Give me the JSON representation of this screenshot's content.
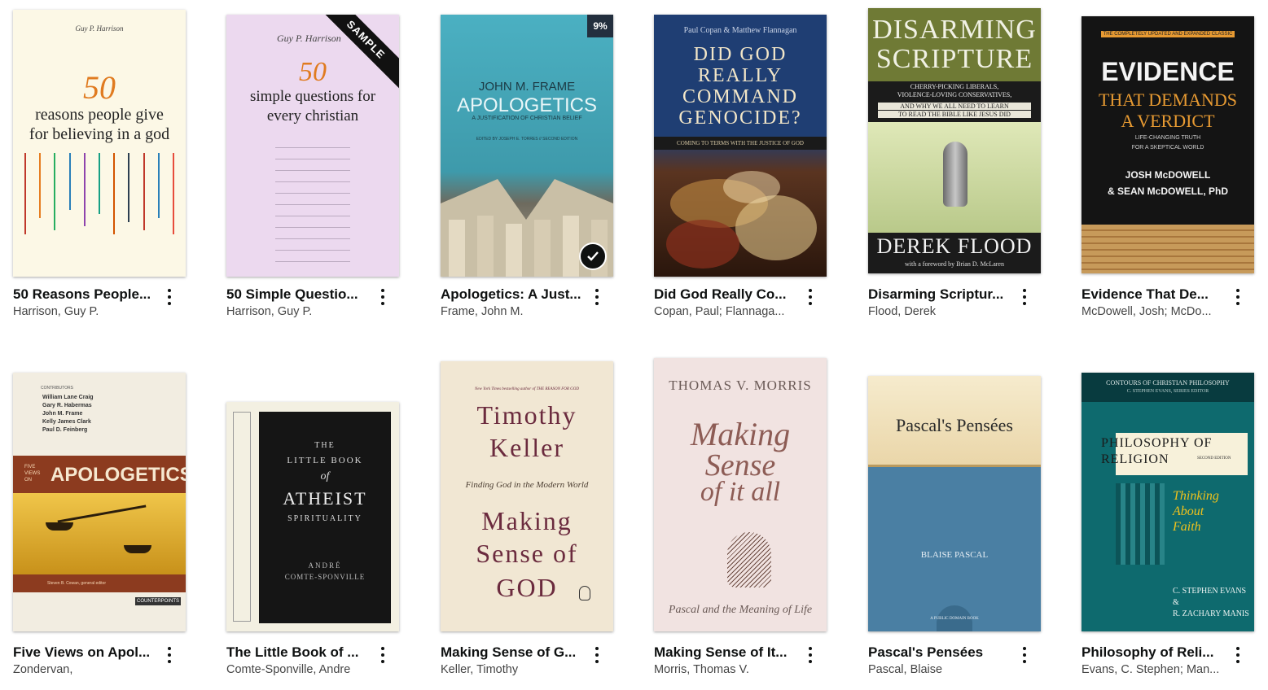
{
  "books": [
    {
      "title": "50 Reasons People...",
      "author": "Harrison, Guy P.",
      "cover": {
        "author": "Guy P. Harrison",
        "number": "50",
        "line1": "reasons people give",
        "line2": "for believing in a god",
        "bg": "#fcf8e6"
      }
    },
    {
      "title": "50 Simple Questio...",
      "author": "Harrison, Guy P.",
      "badge": "SAMPLE",
      "cover": {
        "author": "Guy P. Harrison",
        "number": "50",
        "line1": "simple questions for",
        "line2": "every christian",
        "bg": "#ecd9ef"
      }
    },
    {
      "title": "Apologetics: A Just...",
      "author": "Frame, John M.",
      "progress": "9%",
      "cover": {
        "author": "JOHN M. FRAME",
        "main": "APOLOGETICS",
        "sub": "A JUSTIFICATION OF CHRISTIAN BELIEF",
        "editor": "EDITED BY JOSEPH E. TORRES // SECOND EDITION",
        "bg": "#3e9aab"
      }
    },
    {
      "title": "Did God Really Co...",
      "author": "Copan, Paul; Flannaga...",
      "cover": {
        "author": "Paul Copan & Matthew Flannagan",
        "l1": "DID GOD",
        "l2": "REALLY",
        "l3": "COMMAND",
        "l4": "GENOCIDE?",
        "sub": "COMING TO TERMS WITH THE JUSTICE OF GOD",
        "bg": "#1f3e73"
      }
    },
    {
      "title": "Disarming Scriptur...",
      "author": "Flood, Derek",
      "cover": {
        "l1": "DISARMING",
        "l2": "SCRIPTURE",
        "sub1": "CHERRY-PICKING LIBERALS,",
        "sub2": "VIOLENCE-LOVING CONSERVATIVES,",
        "sub3": "AND WHY WE ALL NEED TO LEARN",
        "sub4": "TO READ THE BIBLE LIKE JESUS DID",
        "author": "DEREK FLOOD",
        "foreword": "with a foreword by Brian D. McLaren",
        "bg": "#1b1b1b"
      }
    },
    {
      "title": "Evidence That De...",
      "author": "McDowell, Josh; McDo...",
      "cover": {
        "banner": "THE COMPLETELY UPDATED AND EXPANDED CLASSIC",
        "l1": "EVIDENCE",
        "l2": "THAT DEMANDS",
        "l3": "A VERDICT",
        "sub1": "LIFE-CHANGING TRUTH",
        "sub2": "FOR A SKEPTICAL WORLD",
        "a1": "JOSH McDOWELL",
        "a2": "& SEAN McDOWELL, PhD",
        "bg": "#141414"
      }
    },
    {
      "title": "Five Views on Apol...",
      "author": "Zondervan,",
      "cover": {
        "contributors_label": "CONTRIBUTORS",
        "names": [
          "William Lane Craig",
          "Gary R. Habermas",
          "John M. Frame",
          "Kelly James Clark",
          "Paul D. Feinberg"
        ],
        "prefix": "FIVE VIEWS ON",
        "main": "APOLOGETICS",
        "editors": "Steven B. Cowan, general editor",
        "series": "COUNTERPOINTS",
        "bg": "#e8c44a"
      }
    },
    {
      "title": "The Little Book of ...",
      "author": "Comte-Sponville, Andre",
      "cover": {
        "l1": "THE",
        "l2": "LITTLE BOOK",
        "l3": "of",
        "l4": "ATHEIST",
        "l5": "SPIRITUALITY",
        "author1": "ANDRÉ",
        "author2": "COMTE-SPONVILLE",
        "bg": "#f3f0e2"
      }
    },
    {
      "title": "Making Sense of G...",
      "author": "Keller, Timothy",
      "cover": {
        "tag": "New York Times bestselling author of THE REASON FOR GOD",
        "a1": "Timothy",
        "a2": "Keller",
        "sub": "Finding God in the Modern World",
        "t1": "Making",
        "t2": "Sense of",
        "t3": "GOD",
        "bg": "#f1e7d3"
      }
    },
    {
      "title": "Making Sense of It...",
      "author": "Morris, Thomas V.",
      "cover": {
        "author": "THOMAS V. MORRIS",
        "t1": "Making",
        "t2": "Sense",
        "t3": "of it all",
        "sub": "Pascal and the Meaning of Life",
        "bg": "#f1e3e1"
      }
    },
    {
      "title": "Pascal's Pensées",
      "author": "Pascal, Blaise",
      "cover": {
        "title": "Pascal's Pensées",
        "author": "BLAISE PASCAL",
        "seal": "A PUBLIC DOMAIN BOOK",
        "bg": "#4a7fa3"
      }
    },
    {
      "title": "Philosophy of Reli...",
      "author": "Evans, C. Stephen; Man...",
      "cover": {
        "series": "CONTOURS OF CHRISTIAN PHILOSOPHY",
        "editor": "C. STEPHEN EVANS, SERIES EDITOR",
        "t1": "PHILOSOPHY OF",
        "t2": "RELIGION",
        "edition": "SECOND EDITION",
        "s1": "Thinking",
        "s2": "About",
        "s3": "Faith",
        "a1": "C. STEPHEN EVANS &",
        "a2": "R. ZACHARY MANIS",
        "bg": "#0e6a6e"
      }
    }
  ]
}
